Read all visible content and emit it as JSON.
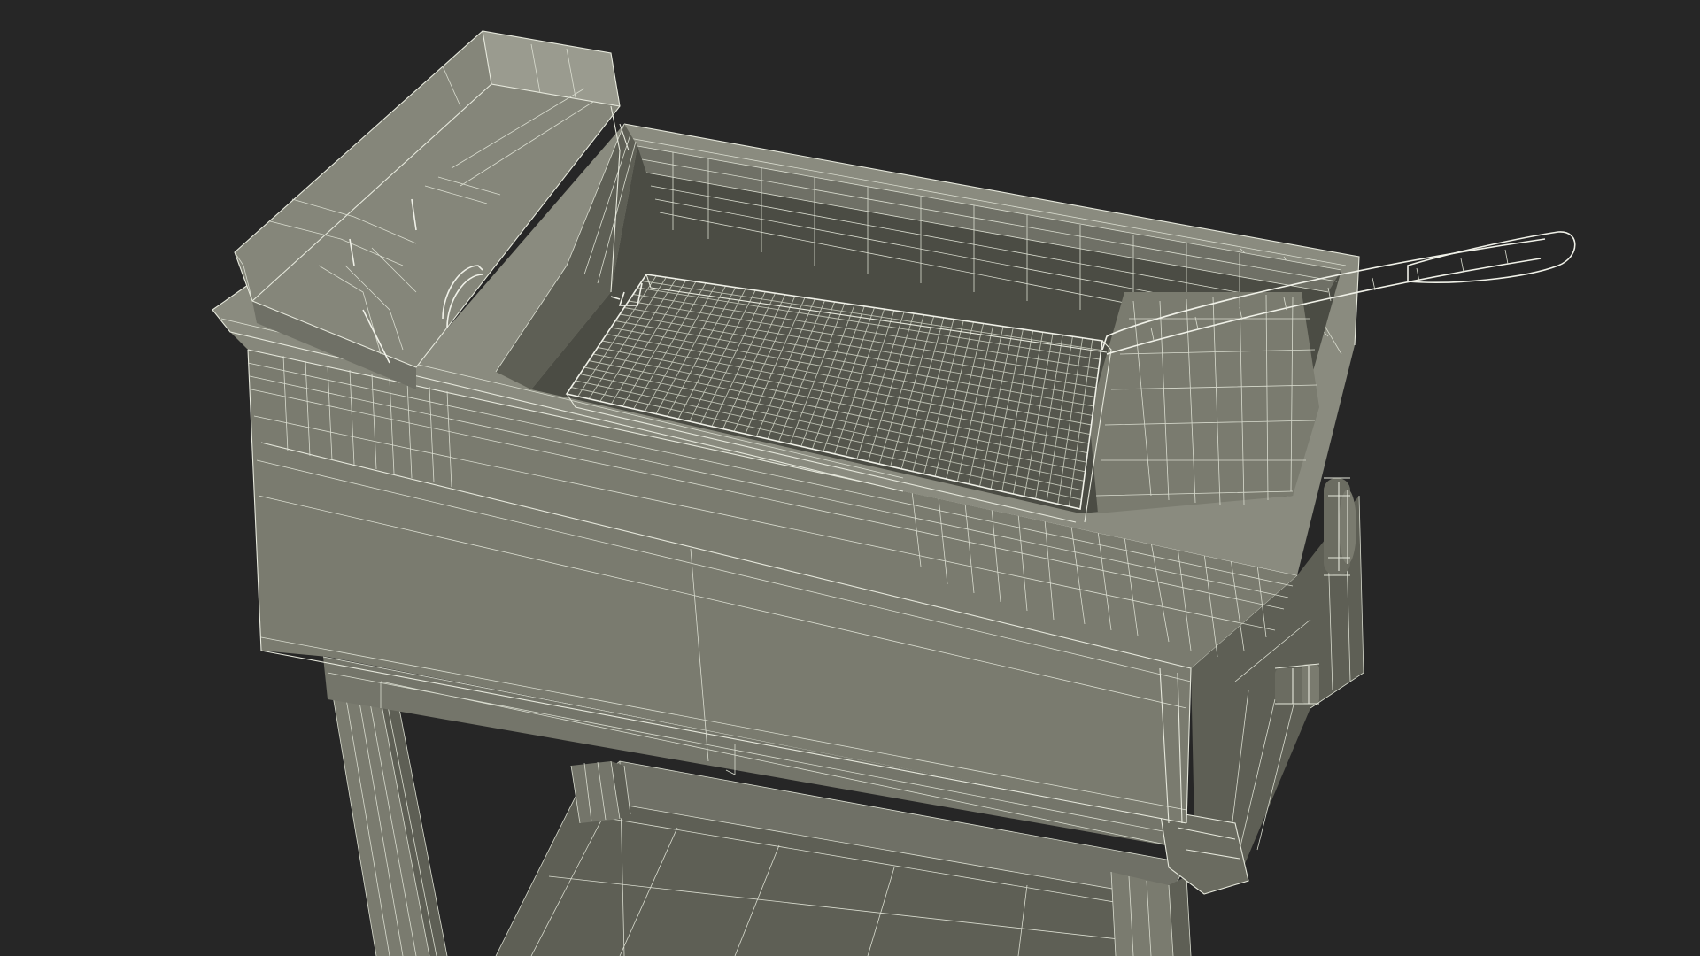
{
  "scene": {
    "subject": "deep-fryer-wireframe",
    "colors": {
      "background": "#262626",
      "surface": "#7a7b6f",
      "surface_dark": "#5e5f55",
      "surface_inner": "#6b6c61",
      "wire": "#e6e8dc",
      "basket_mesh": "#bfc2b4"
    }
  }
}
